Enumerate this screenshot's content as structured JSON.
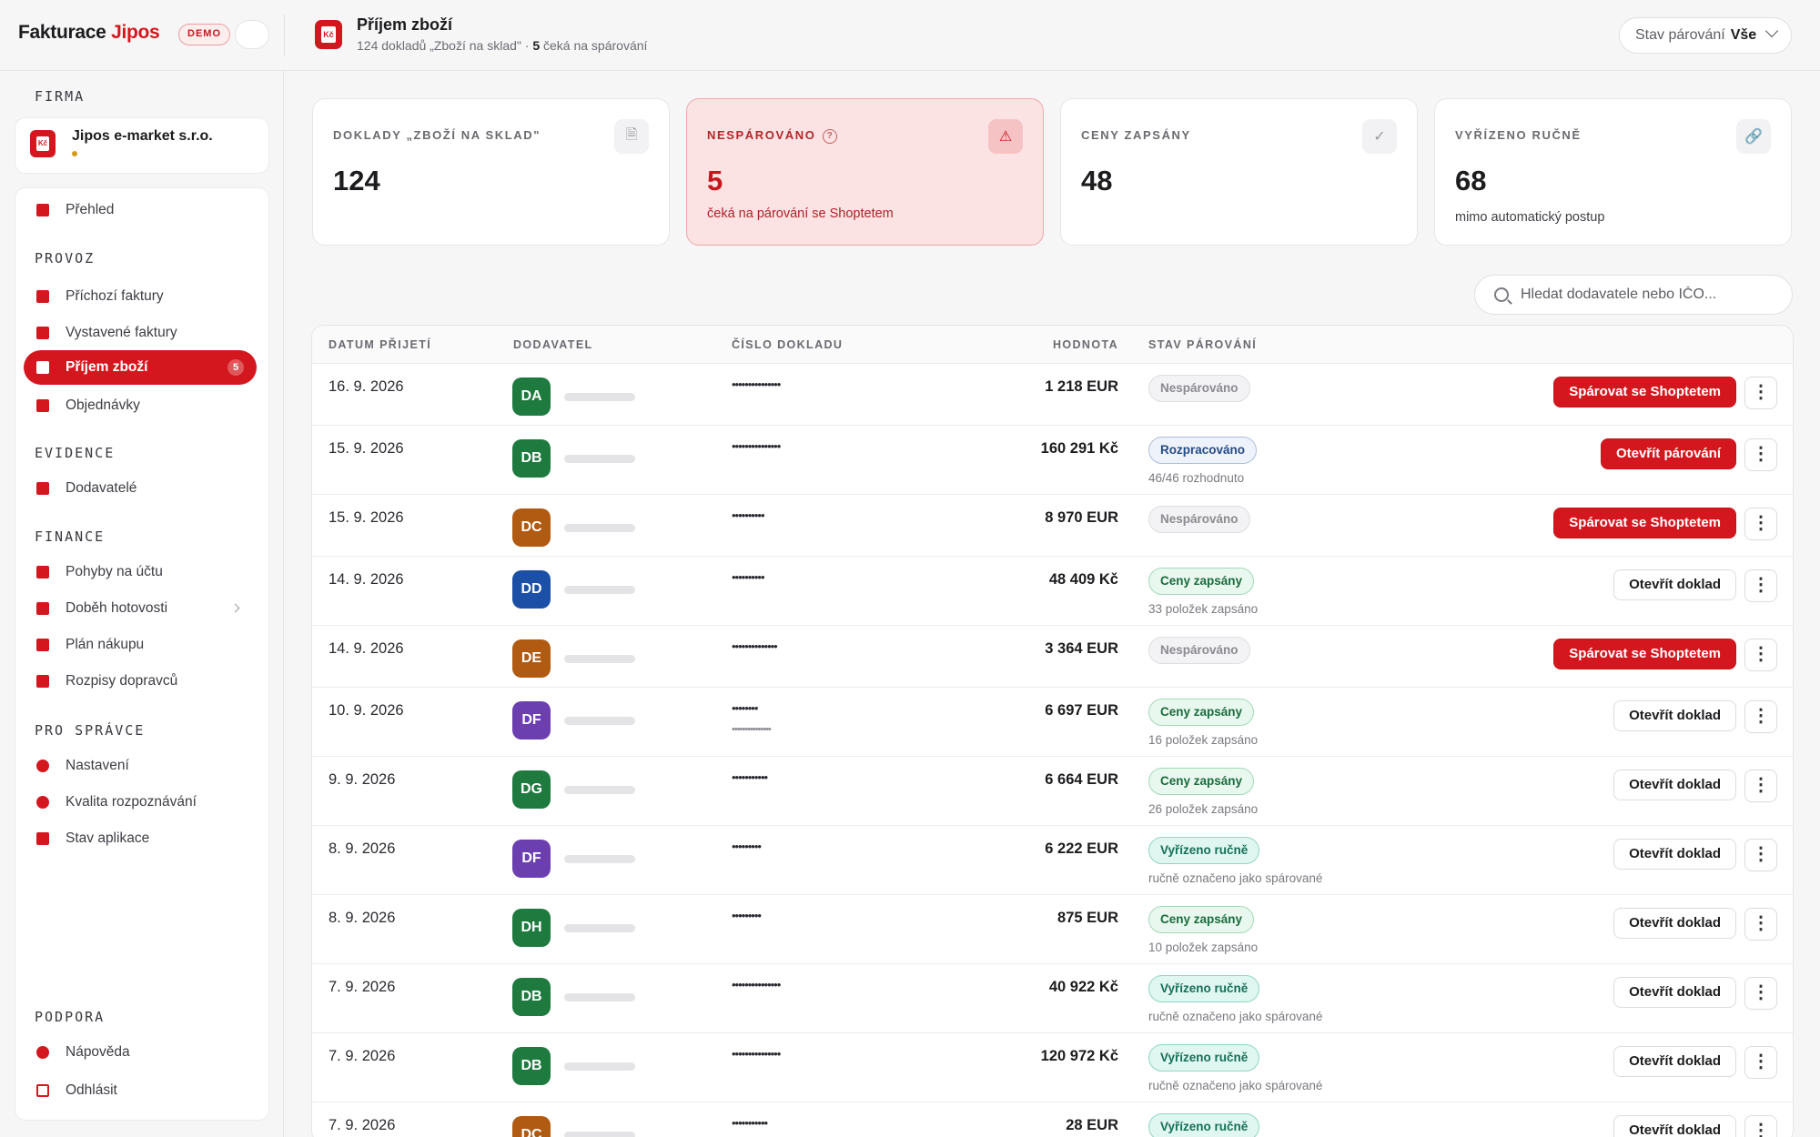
{
  "app": {
    "brand_a": "Fakturace",
    "brand_b": "Jipos",
    "demo": "DEMO"
  },
  "header": {
    "title": "Příjem zboží",
    "subtitle_pre": "124 dokladů „Zboží na sklad\" · ",
    "subtitle_bold": "5",
    "subtitle_post": " čeká na spárování",
    "filter_label": "Stav párování",
    "filter_value": "Vše"
  },
  "sidebar": {
    "firm_label": "FIRMA",
    "firm_name": "Jipos e-market s.r.o.",
    "overview": "Přehled",
    "sections": {
      "provoz": "PROVOZ",
      "evidence": "EVIDENCE",
      "finance": "FINANCE",
      "spravce": "PRO SPRÁVCE",
      "podpora": "PODPORA"
    },
    "items": {
      "incoming": "Příchozí faktury",
      "issued": "Vystavené faktury",
      "goods": "Příjem zboží",
      "goods_badge": "5",
      "orders": "Objednávky",
      "suppliers": "Dodavatelé",
      "bank": "Pohyby na účtu",
      "cash": "Doběh hotovosti",
      "purchase": "Plán nákupu",
      "carriers": "Rozpisy dopravců",
      "settings": "Nastavení",
      "quality": "Kvalita rozpoznávání",
      "status": "Stav aplikace",
      "help": "Nápověda",
      "logout": "Odhlásit"
    },
    "colors": {
      "accent": "#d4171e"
    }
  },
  "stats": [
    {
      "label": "DOKLADY „ZBOŽÍ NA SKLAD\"",
      "value": "124",
      "sub": "",
      "icon": "document-icon"
    },
    {
      "label": "NESPÁROVÁNO",
      "value": "5",
      "sub": "čeká na párování se Shoptetem",
      "icon": "warning-icon"
    },
    {
      "label": "CENY ZAPSÁNY",
      "value": "48",
      "sub": "",
      "icon": "check-icon"
    },
    {
      "label": "VYŘÍZENO RUČNĚ",
      "value": "68",
      "sub": "mimo automatický postup",
      "icon": "link-icon"
    }
  ],
  "search": {
    "placeholder": "Hledat dodavatele nebo IČO..."
  },
  "table": {
    "columns": {
      "date": "DATUM PŘIJETÍ",
      "supplier": "DODAVATEL",
      "doc": "ČÍSLO DOKLADU",
      "value": "HODNOTA",
      "status": "STAV PÁROVÁNÍ"
    },
    "rows": [
      {
        "date": "16. 9. 2026",
        "avatar": "DA",
        "color": "#1f7a3f",
        "doc": "•••••••••••••••",
        "doc2": "",
        "value": "1 218 EUR",
        "status": "Nespárováno",
        "status_type": "gray",
        "note": "",
        "action": "Spárovat se Shoptetem",
        "action_type": "red"
      },
      {
        "date": "15. 9. 2026",
        "avatar": "DB",
        "color": "#1f7a3f",
        "doc": "•••••••••••••••",
        "doc2": "",
        "value": "160 291 Kč",
        "status": "Rozpracováno",
        "status_type": "blue",
        "note": "46/46 rozhodnuto",
        "action": "Otevřít párování",
        "action_type": "red"
      },
      {
        "date": "15. 9. 2026",
        "avatar": "DC",
        "color": "#b05a12",
        "doc": "••••••••••",
        "doc2": "",
        "value": "8 970 EUR",
        "status": "Nespárováno",
        "status_type": "gray",
        "note": "",
        "action": "Spárovat se Shoptetem",
        "action_type": "red"
      },
      {
        "date": "14. 9. 2026",
        "avatar": "DD",
        "color": "#1c4fa6",
        "doc": "••••••••••",
        "doc2": "",
        "value": "48 409 Kč",
        "status": "Ceny zapsány",
        "status_type": "green",
        "note": "33 položek zapsáno",
        "action": "Otevřít doklad",
        "action_type": "white"
      },
      {
        "date": "14. 9. 2026",
        "avatar": "DE",
        "color": "#b05a12",
        "doc": "••••••••••••••",
        "doc2": "",
        "value": "3 364 EUR",
        "status": "Nespárováno",
        "status_type": "gray",
        "note": "",
        "action": "Spárovat se Shoptetem",
        "action_type": "red"
      },
      {
        "date": "10. 9. 2026",
        "avatar": "DF",
        "color": "#6b3fb0",
        "doc": "••••••••",
        "doc2": "•••••••••••••••",
        "value": "6 697 EUR",
        "status": "Ceny zapsány",
        "status_type": "green",
        "note": "16 položek zapsáno",
        "action": "Otevřít doklad",
        "action_type": "white"
      },
      {
        "date": "9. 9. 2026",
        "avatar": "DG",
        "color": "#1f7a3f",
        "doc": "•••••••••••",
        "doc2": "",
        "value": "6 664 EUR",
        "status": "Ceny zapsány",
        "status_type": "green",
        "note": "26 položek zapsáno",
        "action": "Otevřít doklad",
        "action_type": "white"
      },
      {
        "date": "8. 9. 2026",
        "avatar": "DF",
        "color": "#6b3fb0",
        "doc": "•••••••••",
        "doc2": "",
        "value": "6 222 EUR",
        "status": "Vyřízeno ručně",
        "status_type": "teal",
        "note": "ručně označeno jako spárované",
        "action": "Otevřít doklad",
        "action_type": "white"
      },
      {
        "date": "8. 9. 2026",
        "avatar": "DH",
        "color": "#1f7a3f",
        "doc": "•••••••••",
        "doc2": "",
        "value": "875 EUR",
        "status": "Ceny zapsány",
        "status_type": "green",
        "note": "10 položek zapsáno",
        "action": "Otevřít doklad",
        "action_type": "white"
      },
      {
        "date": "7. 9. 2026",
        "avatar": "DB",
        "color": "#1f7a3f",
        "doc": "•••••••••••••••",
        "doc2": "",
        "value": "40 922 Kč",
        "status": "Vyřízeno ručně",
        "status_type": "teal",
        "note": "ručně označeno jako spárované",
        "action": "Otevřít doklad",
        "action_type": "white"
      },
      {
        "date": "7. 9. 2026",
        "avatar": "DB",
        "color": "#1f7a3f",
        "doc": "•••••••••••••••",
        "doc2": "",
        "value": "120 972 Kč",
        "status": "Vyřízeno ručně",
        "status_type": "teal",
        "note": "ručně označeno jako spárované",
        "action": "Otevřít doklad",
        "action_type": "white"
      },
      {
        "date": "7. 9. 2026",
        "avatar": "DC",
        "color": "#b05a12",
        "doc": "•••••••••••",
        "doc2": "",
        "value": "28 EUR",
        "status": "Vyřízeno ručně",
        "status_type": "teal",
        "note": "",
        "action": "Otevřít doklad",
        "action_type": "white"
      }
    ]
  }
}
